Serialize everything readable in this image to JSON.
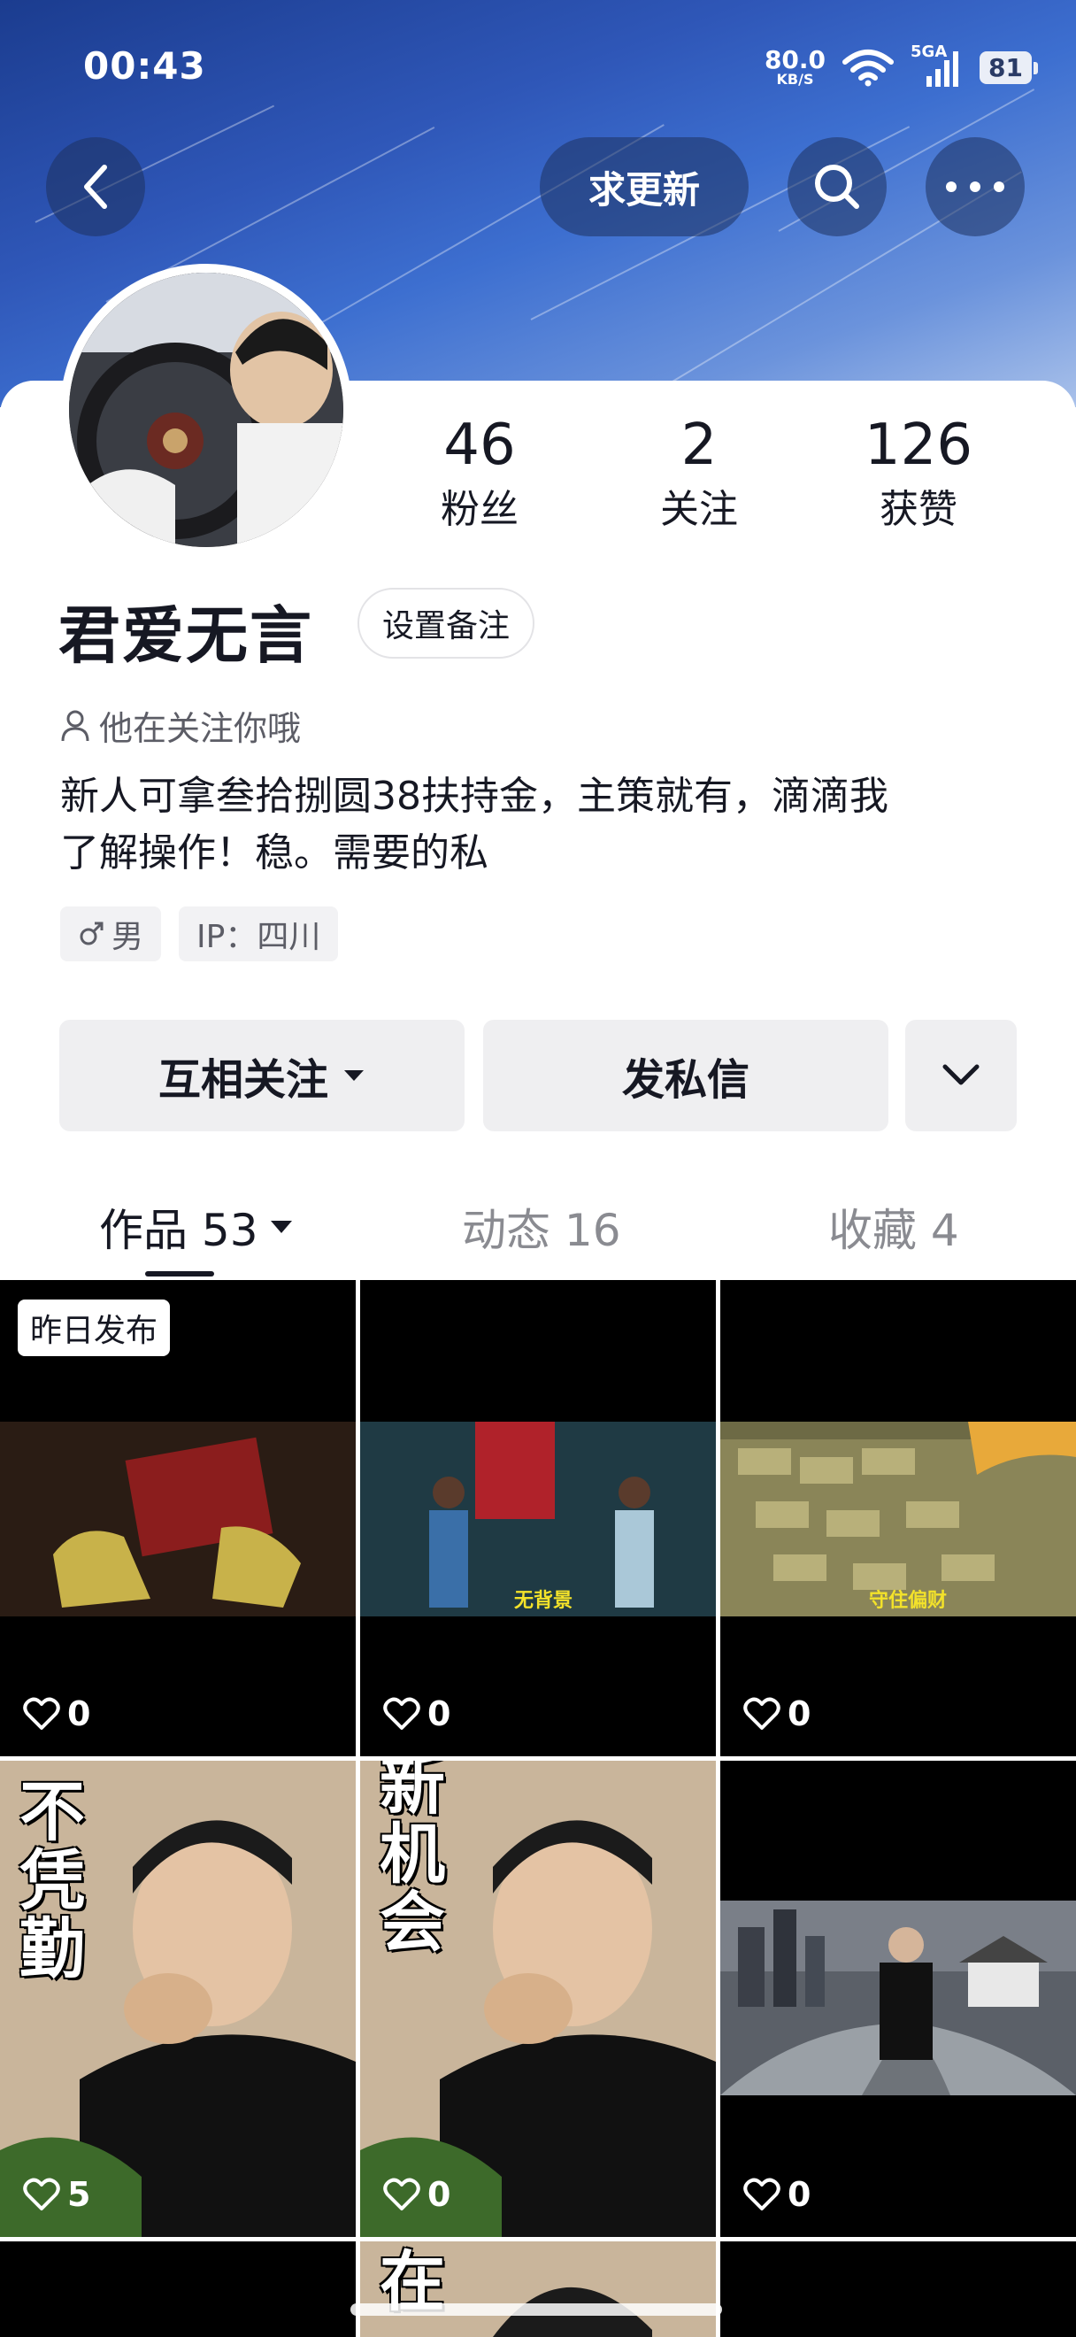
{
  "status_bar": {
    "time": "00:43",
    "net_speed": "80.0",
    "net_unit": "KB/S",
    "signal": "5GA",
    "battery": "81"
  },
  "top_nav": {
    "update_label": "求更新"
  },
  "profile": {
    "followers": {
      "value": "46",
      "label": "粉丝"
    },
    "following": {
      "value": "2",
      "label": "关注"
    },
    "likes": {
      "value": "126",
      "label": "获赞"
    },
    "nickname": "君爱无言",
    "remark_label": "设置备注",
    "follow_hint": "他在关注你哦",
    "bio_line1": "新人可拿叁拾捌圆38扶持金，主策就有，滴滴我",
    "bio_line2": "了解操作！稳。需要的私",
    "gender": "男",
    "ip": "IP：四川"
  },
  "actions": {
    "mutual_follow": "互相关注",
    "message": "发私信"
  },
  "tabs": [
    {
      "label": "作品 53",
      "active": true
    },
    {
      "label": "动态 16",
      "active": false
    },
    {
      "label": "收藏 4",
      "active": false
    }
  ],
  "grid": {
    "badge": "昨日发布",
    "items": [
      {
        "likes": "0",
        "caption": ""
      },
      {
        "likes": "0",
        "caption": "无背景"
      },
      {
        "likes": "0",
        "caption": "守住偏财"
      },
      {
        "likes": "5",
        "caption": "不凭勤"
      },
      {
        "likes": "0",
        "caption": "新机会"
      },
      {
        "likes": "0",
        "caption": ""
      }
    ],
    "partial_text": "在"
  },
  "colors": {
    "banner": "#2f57b8",
    "text": "#161823",
    "muted": "#8a8b91",
    "button_bg": "#efeff1"
  }
}
